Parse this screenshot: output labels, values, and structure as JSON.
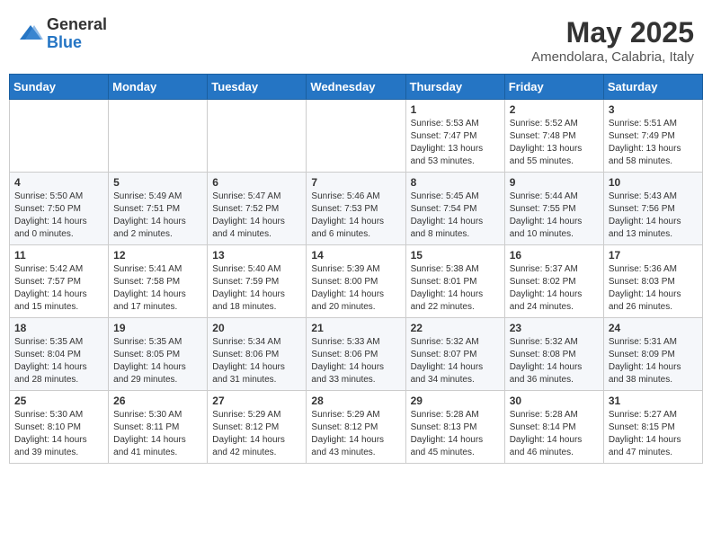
{
  "header": {
    "logo_general": "General",
    "logo_blue": "Blue",
    "title": "May 2025",
    "subtitle": "Amendolara, Calabria, Italy"
  },
  "weekdays": [
    "Sunday",
    "Monday",
    "Tuesday",
    "Wednesday",
    "Thursday",
    "Friday",
    "Saturday"
  ],
  "weeks": [
    [
      {
        "day": "",
        "info": ""
      },
      {
        "day": "",
        "info": ""
      },
      {
        "day": "",
        "info": ""
      },
      {
        "day": "",
        "info": ""
      },
      {
        "day": "1",
        "info": "Sunrise: 5:53 AM\nSunset: 7:47 PM\nDaylight: 13 hours\nand 53 minutes."
      },
      {
        "day": "2",
        "info": "Sunrise: 5:52 AM\nSunset: 7:48 PM\nDaylight: 13 hours\nand 55 minutes."
      },
      {
        "day": "3",
        "info": "Sunrise: 5:51 AM\nSunset: 7:49 PM\nDaylight: 13 hours\nand 58 minutes."
      }
    ],
    [
      {
        "day": "4",
        "info": "Sunrise: 5:50 AM\nSunset: 7:50 PM\nDaylight: 14 hours\nand 0 minutes."
      },
      {
        "day": "5",
        "info": "Sunrise: 5:49 AM\nSunset: 7:51 PM\nDaylight: 14 hours\nand 2 minutes."
      },
      {
        "day": "6",
        "info": "Sunrise: 5:47 AM\nSunset: 7:52 PM\nDaylight: 14 hours\nand 4 minutes."
      },
      {
        "day": "7",
        "info": "Sunrise: 5:46 AM\nSunset: 7:53 PM\nDaylight: 14 hours\nand 6 minutes."
      },
      {
        "day": "8",
        "info": "Sunrise: 5:45 AM\nSunset: 7:54 PM\nDaylight: 14 hours\nand 8 minutes."
      },
      {
        "day": "9",
        "info": "Sunrise: 5:44 AM\nSunset: 7:55 PM\nDaylight: 14 hours\nand 10 minutes."
      },
      {
        "day": "10",
        "info": "Sunrise: 5:43 AM\nSunset: 7:56 PM\nDaylight: 14 hours\nand 13 minutes."
      }
    ],
    [
      {
        "day": "11",
        "info": "Sunrise: 5:42 AM\nSunset: 7:57 PM\nDaylight: 14 hours\nand 15 minutes."
      },
      {
        "day": "12",
        "info": "Sunrise: 5:41 AM\nSunset: 7:58 PM\nDaylight: 14 hours\nand 17 minutes."
      },
      {
        "day": "13",
        "info": "Sunrise: 5:40 AM\nSunset: 7:59 PM\nDaylight: 14 hours\nand 18 minutes."
      },
      {
        "day": "14",
        "info": "Sunrise: 5:39 AM\nSunset: 8:00 PM\nDaylight: 14 hours\nand 20 minutes."
      },
      {
        "day": "15",
        "info": "Sunrise: 5:38 AM\nSunset: 8:01 PM\nDaylight: 14 hours\nand 22 minutes."
      },
      {
        "day": "16",
        "info": "Sunrise: 5:37 AM\nSunset: 8:02 PM\nDaylight: 14 hours\nand 24 minutes."
      },
      {
        "day": "17",
        "info": "Sunrise: 5:36 AM\nSunset: 8:03 PM\nDaylight: 14 hours\nand 26 minutes."
      }
    ],
    [
      {
        "day": "18",
        "info": "Sunrise: 5:35 AM\nSunset: 8:04 PM\nDaylight: 14 hours\nand 28 minutes."
      },
      {
        "day": "19",
        "info": "Sunrise: 5:35 AM\nSunset: 8:05 PM\nDaylight: 14 hours\nand 29 minutes."
      },
      {
        "day": "20",
        "info": "Sunrise: 5:34 AM\nSunset: 8:06 PM\nDaylight: 14 hours\nand 31 minutes."
      },
      {
        "day": "21",
        "info": "Sunrise: 5:33 AM\nSunset: 8:06 PM\nDaylight: 14 hours\nand 33 minutes."
      },
      {
        "day": "22",
        "info": "Sunrise: 5:32 AM\nSunset: 8:07 PM\nDaylight: 14 hours\nand 34 minutes."
      },
      {
        "day": "23",
        "info": "Sunrise: 5:32 AM\nSunset: 8:08 PM\nDaylight: 14 hours\nand 36 minutes."
      },
      {
        "day": "24",
        "info": "Sunrise: 5:31 AM\nSunset: 8:09 PM\nDaylight: 14 hours\nand 38 minutes."
      }
    ],
    [
      {
        "day": "25",
        "info": "Sunrise: 5:30 AM\nSunset: 8:10 PM\nDaylight: 14 hours\nand 39 minutes."
      },
      {
        "day": "26",
        "info": "Sunrise: 5:30 AM\nSunset: 8:11 PM\nDaylight: 14 hours\nand 41 minutes."
      },
      {
        "day": "27",
        "info": "Sunrise: 5:29 AM\nSunset: 8:12 PM\nDaylight: 14 hours\nand 42 minutes."
      },
      {
        "day": "28",
        "info": "Sunrise: 5:29 AM\nSunset: 8:12 PM\nDaylight: 14 hours\nand 43 minutes."
      },
      {
        "day": "29",
        "info": "Sunrise: 5:28 AM\nSunset: 8:13 PM\nDaylight: 14 hours\nand 45 minutes."
      },
      {
        "day": "30",
        "info": "Sunrise: 5:28 AM\nSunset: 8:14 PM\nDaylight: 14 hours\nand 46 minutes."
      },
      {
        "day": "31",
        "info": "Sunrise: 5:27 AM\nSunset: 8:15 PM\nDaylight: 14 hours\nand 47 minutes."
      }
    ]
  ]
}
